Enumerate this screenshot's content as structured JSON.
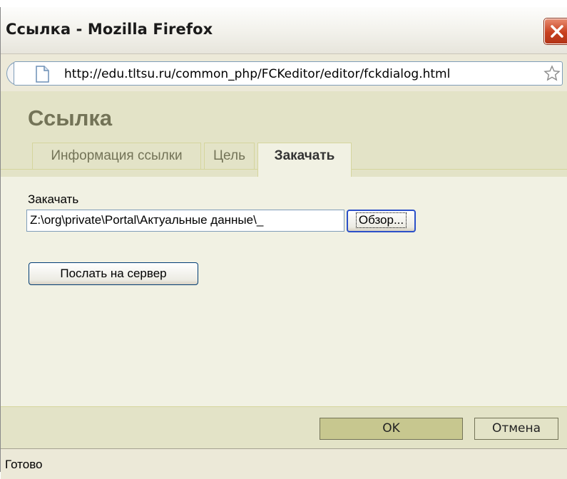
{
  "window": {
    "title": "Ссылка - Mozilla Firefox"
  },
  "urlbar": {
    "url": "http://edu.tltsu.ru/common_php/FCKeditor/editor/fckdialog.html"
  },
  "dialog": {
    "title": "Ссылка",
    "tabs": [
      {
        "label": "Информация ссылки",
        "active": false
      },
      {
        "label": "Цель",
        "active": false
      },
      {
        "label": "Закачать",
        "active": true
      }
    ],
    "upload": {
      "label": "Закачать",
      "file_value": "Z:\\org\\private\\Portal\\Актуальные данные\\_",
      "browse_label": "Обзор...",
      "send_label": "Послать на сервер"
    },
    "footer": {
      "ok_label": "OK",
      "cancel_label": "Отмена"
    }
  },
  "statusbar": {
    "text": "Готово"
  },
  "colors": {
    "header_bg": "#e3e3c7",
    "body_bg": "#f1f1e3",
    "title_color": "#737357",
    "close_red": "#c8401f"
  }
}
